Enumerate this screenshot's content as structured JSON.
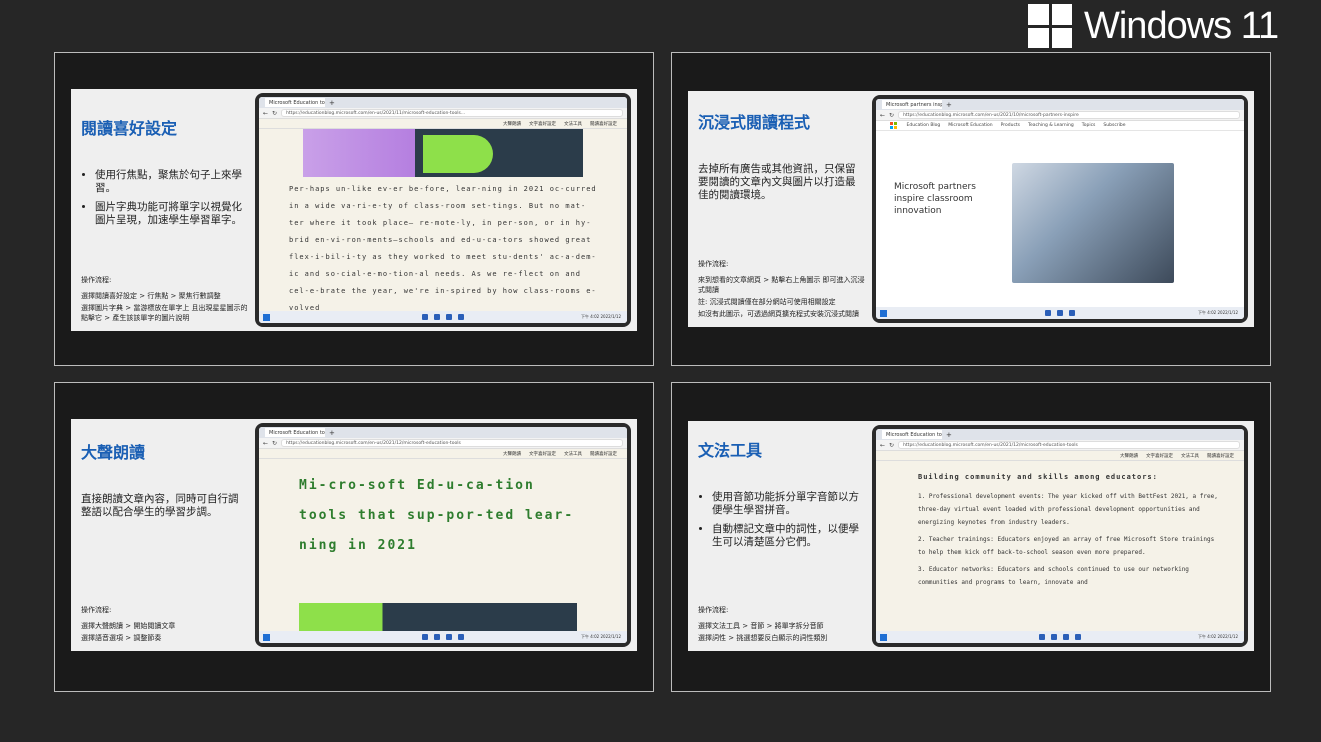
{
  "brand": {
    "title": "Windows 11"
  },
  "panels": [
    {
      "title": "閱讀喜好設定",
      "bullets": [
        "使用行焦點，聚焦於句子上來學習。",
        "圖片字典功能可將單字以視覺化圖片呈現，加速學生學習單字。"
      ],
      "steps_label": "操作流程:",
      "steps": [
        "選擇閱讀喜好設定 > 行焦點 > 聚焦行數調整",
        "選擇圖片字典 > 當游標放在單字上 且出現星星圖示的點擊它 > 產生該該單字的圖片說明"
      ],
      "browser": {
        "tab": "Microsoft Education tools that...",
        "url": "https://educationblog.microsoft.com/en-us/2021/11/microsoft-education-tools...",
        "reader_buttons": [
          "大聲朗讀",
          "文字喜好設定",
          "文法工具",
          "閱讀喜好設定"
        ],
        "text": "Per-haps un-like ev-er be-fore, lear-ning in 2021 oc-curred in a wide va-ri-e-ty of class-room set-tings. But no mat-ter where it took place— re-mote-ly, in per-son, or in hy-brid en-vi-ron-ments—schools and ed-u-ca-tors showed great flex-i-bil-i-ty as they worked to meet stu-dents' ac-a-dem-ic and so-cial-e-mo-tion-al needs. As we re-flect on and cel-e-brate the year, we're in-spired by how class-rooms e-volved",
        "clock": "下午 4:02 2022/1/12"
      }
    },
    {
      "title": "沉浸式閱讀程式",
      "paragraph": "去掉所有廣告或其他資訊，只保留要閱讀的文章內文與圖片以打造最佳的閱讀環境。",
      "steps_label": "操作流程:",
      "steps": [
        "來到想看的文章網頁 > 點擊右上角圖示 即可進入沉浸式閱讀",
        "註: 沉浸式閱讀僅在部分網站可使用相關設定",
        "如沒有此圖示，可透過網頁擴充程式安裝沉浸式閱讀"
      ],
      "browser": {
        "tab": "Microsoft partners inspire...",
        "url": "https://educationblog.microsoft.com/en-us/2021/10/microsoft-partners-inspire",
        "nav_items": [
          "Education Blog",
          "Microsoft Education",
          "Products",
          "Teaching & Learning",
          "Topics",
          "Subscribe"
        ],
        "article_title": "Microsoft partners inspire classroom innovation",
        "clock": "下午 4:02 2022/1/12"
      }
    },
    {
      "title": "大聲朗讀",
      "paragraph": "直接朗讀文章內容，同時可自行調整語以配合學生的學習步調。",
      "steps_label": "操作流程:",
      "steps": [
        "選擇大聲朗讀 > 開始閱讀文章",
        "選擇語音選項 > 調整節奏"
      ],
      "browser": {
        "tab": "Microsoft Education tools that...",
        "url": "https://educationblog.microsoft.com/en-us/2021/12/microsoft-education-tools",
        "reader_buttons": [
          "大聲朗讀",
          "文字喜好設定",
          "文法工具",
          "閱讀喜好設定"
        ],
        "text": "Mi-cro-soft Ed-u-ca-tion tools that sup-por-ted lear-ning in 2021",
        "clock": "下午 4:02 2022/1/12"
      }
    },
    {
      "title": "文法工具",
      "bullets": [
        "使用音節功能拆分單字音節以方便學生學習拼音。",
        "自動標記文章中的詞性，以便學生可以清楚區分它們。"
      ],
      "steps_label": "操作流程:",
      "steps": [
        "選擇文法工具 > 音節 > 將單字拆分音節",
        "選擇詞性 > 挑選想要反白顯示的詞性類別"
      ],
      "browser": {
        "tab": "Microsoft Education tools that...",
        "url": "https://educationblog.microsoft.com/en-us/2021/12/microsoft-education-tools",
        "reader_buttons": [
          "大聲朗讀",
          "文字喜好設定",
          "文法工具",
          "閱讀喜好設定"
        ],
        "heading": "Building community and skills among educators:",
        "items": [
          "1. Professional development events: The year kicked off with BettFest 2021, a free, three-day virtual event loaded with professional development opportunities and energizing keynotes from industry leaders.",
          "2. Teacher trainings: Educators enjoyed an array of free Microsoft Store trainings to help them kick off back-to-school season even more prepared.",
          "3. Educator networks: Educators and schools continued to use our networking communities and programs to learn, innovate and"
        ],
        "clock": "下午 4:02 2022/1/12"
      }
    }
  ]
}
